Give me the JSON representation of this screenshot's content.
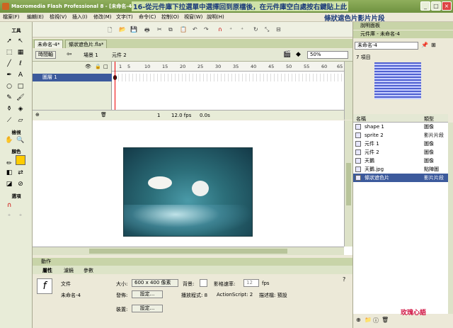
{
  "window": {
    "title": "Macromedia Flash Professional 8 - [未命名-4*]",
    "note": "16-從元件庫下拉選單中選擇回到原檔後，在元件庫空白處按右鍵貼上此",
    "note2": "條狀遮色片影片片段"
  },
  "menu": [
    "檔案(F)",
    "編輯(E)",
    "檢視(V)",
    "插入(I)",
    "修改(M)",
    "文字(T)",
    "命令(C)",
    "控制(O)",
    "視窗(W)",
    "說明(H)"
  ],
  "tools": {
    "section_view": "檢視",
    "section_color": "顏色",
    "section_options": "選項",
    "title": "工具"
  },
  "doc_tabs": [
    "未命名-4*",
    "條狀遮色片.fla*"
  ],
  "editbar": {
    "timeline_btn": "時間軸",
    "scene": "場景 1",
    "symbol": "元件 2",
    "zoom": "50%"
  },
  "timeline": {
    "ticks": [
      "1",
      "5",
      "10",
      "15",
      "20",
      "25",
      "30",
      "35",
      "40",
      "45",
      "50",
      "55",
      "60",
      "65"
    ],
    "layer": "圖層 1",
    "frame": "1",
    "fps": "12.0 fps",
    "time": "0.0s"
  },
  "props": {
    "header": "動作",
    "tabs": [
      "屬性",
      "濾鏡",
      "參數"
    ],
    "doc_label": "文件",
    "doc_name": "未命名-4",
    "size_label": "大小:",
    "size_val": "600 x 400 像素",
    "bg_label": "背景:",
    "rate_label": "影格速率:",
    "rate_val": "12",
    "fps": "fps",
    "publish_label": "發佈:",
    "settings_btn": "設定...",
    "player_label": "播放程式: 8",
    "as_label": "ActionScript: 2",
    "profile_label": "描述檔: 預設",
    "device_label": "裝置:"
  },
  "library": {
    "panel1": "說明面板",
    "panel2": "元件庫 - 未命名-4",
    "doc_select": "未命名-4",
    "count": "7 項目",
    "col_name": "名稱",
    "col_type": "類型",
    "items": [
      {
        "name": "shape 1",
        "type": "圖像"
      },
      {
        "name": "sprite 2",
        "type": "影片片段"
      },
      {
        "name": "元件 1",
        "type": "圖像"
      },
      {
        "name": "元件 2",
        "type": "圖像"
      },
      {
        "name": "天鵝",
        "type": "圖像"
      },
      {
        "name": "天鵝.jpg",
        "type": "點陣圖"
      },
      {
        "name": "條狀遮色片",
        "type": "影片片段"
      }
    ]
  },
  "watermark": "玫瑰心語"
}
